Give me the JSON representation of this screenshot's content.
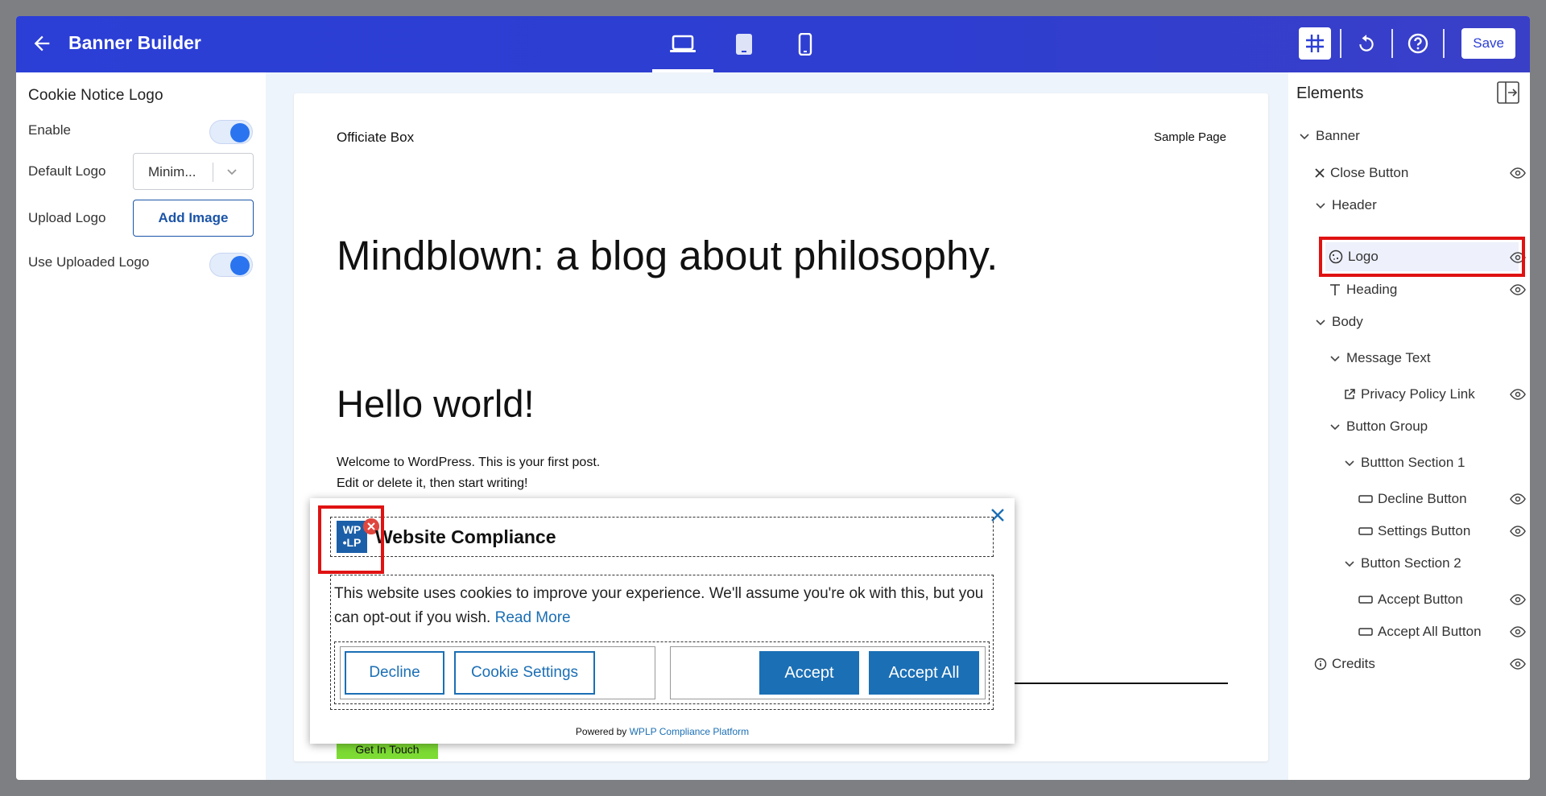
{
  "header": {
    "title": "Banner Builder",
    "save_label": "Save",
    "devices": [
      "desktop-icon",
      "tablet-icon",
      "mobile-icon"
    ],
    "accent": "#2b3fd6"
  },
  "left_panel": {
    "title": "Cookie Notice Logo",
    "enable_label": "Enable",
    "enable_on": true,
    "default_logo_label": "Default Logo",
    "default_logo_value": "Minim...",
    "upload_logo_label": "Upload Logo",
    "add_image_label": "Add Image",
    "use_uploaded_label": "Use Uploaded Logo",
    "use_uploaded_on": true
  },
  "preview": {
    "site_name": "Officiate Box",
    "nav_link": "Sample Page",
    "site_heading": "Mindblown: a blog about philosophy.",
    "post_title": "Hello world!",
    "post_line1": "Welcome to WordPress. This is your first post.",
    "post_line2": "Edit or delete it, then start writing!",
    "get_in_touch": "Get In Touch",
    "banner": {
      "logo_text_line1": "WP",
      "logo_text_line2": "•LP",
      "heading": "Website Compliance",
      "message": "This website uses cookies to improve your experience. We'll assume you're ok with this, but you can opt-out if you wish.",
      "read_more": "Read More",
      "decline": "Decline",
      "cookie_settings": "Cookie Settings",
      "accept": "Accept",
      "accept_all": "Accept All",
      "powered_by": "Powered by",
      "powered_link": "WPLP Compliance Platform",
      "button_color": "#1b6fb5"
    }
  },
  "elements_panel": {
    "title": "Elements",
    "items": [
      {
        "label": "Banner"
      },
      {
        "label": "Close Button"
      },
      {
        "label": "Header"
      },
      {
        "label": "Logo"
      },
      {
        "label": "Heading"
      },
      {
        "label": "Body"
      },
      {
        "label": "Message Text"
      },
      {
        "label": "Privacy Policy Link"
      },
      {
        "label": "Button Group"
      },
      {
        "label": "Buttton Section 1"
      },
      {
        "label": "Decline Button"
      },
      {
        "label": "Settings Button"
      },
      {
        "label": "Button Section 2"
      },
      {
        "label": "Accept Button"
      },
      {
        "label": "Accept All Button"
      },
      {
        "label": "Credits"
      }
    ]
  }
}
